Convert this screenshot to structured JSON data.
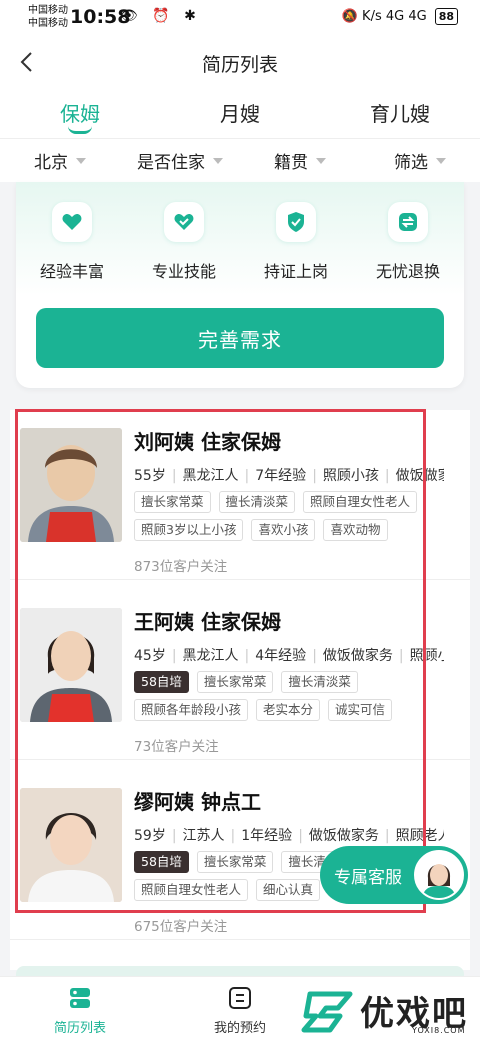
{
  "status_bar": {
    "carrier1": "中国移动",
    "carrier2": "中国移动",
    "time": "10:58",
    "left_icons": "👁 ⏰ ✱",
    "right_icons": "🔕 K/s 4G 4G",
    "battery": "88"
  },
  "navbar": {
    "title": "简历列表"
  },
  "tabs": [
    {
      "label": "保姆",
      "active": true
    },
    {
      "label": "月嫂",
      "active": false
    },
    {
      "label": "育儿嫂",
      "active": false
    }
  ],
  "filters": [
    {
      "label": "北京"
    },
    {
      "label": "是否住家"
    },
    {
      "label": "籍贯"
    },
    {
      "label": "筛选"
    }
  ],
  "promo": {
    "features": [
      {
        "label": "经验丰富",
        "icon": "heart-icon"
      },
      {
        "label": "专业技能",
        "icon": "check-heart-icon"
      },
      {
        "label": "持证上岗",
        "icon": "shield-check-icon"
      },
      {
        "label": "无忧退换",
        "icon": "swap-icon"
      }
    ],
    "cta_label": "完善需求"
  },
  "caregivers": [
    {
      "name": "刘阿姨 住家保姆",
      "age": "55岁",
      "origin": "黑龙江人",
      "experience": "7年经验",
      "skill1": "照顾小孩",
      "skill2": "做饭做家",
      "tags": [
        "擅长家常菜",
        "擅长清淡菜",
        "照顾自理女性老人",
        "照顾3岁以上小孩",
        "喜欢小孩",
        "喜欢动物"
      ],
      "followers": "873位客户关注"
    },
    {
      "name": "王阿姨 住家保姆",
      "age": "45岁",
      "origin": "黑龙江人",
      "experience": "4年经验",
      "skill1": "做饭做家务",
      "skill2": "照顾小孩",
      "badge": "58自培",
      "tags": [
        "擅长家常菜",
        "擅长清淡菜",
        "照顾各年龄段小孩",
        "老实本分",
        "诚实可信"
      ],
      "followers": "73位客户关注"
    },
    {
      "name": "缪阿姨 钟点工",
      "age": "59岁",
      "origin": "江苏人",
      "experience": "1年经验",
      "skill1": "做饭做家务",
      "skill2": "照顾老人",
      "badge": "58自培",
      "tags": [
        "擅长家常菜",
        "擅长清淡菜",
        "照顾自理女性老人",
        "细心认真"
      ],
      "followers": "675位客户关注"
    }
  ],
  "service": {
    "label": "专属客服"
  },
  "bottom_nav": [
    {
      "label": "简历列表",
      "icon": "list-icon",
      "active": true
    },
    {
      "label": "我的预约",
      "icon": "appointment-icon",
      "active": false
    }
  ],
  "watermark": {
    "text": "优戏吧",
    "sub": "YOXI8.COM"
  },
  "colors": {
    "accent": "#1bb394",
    "highlight": "#e03e4e",
    "badge_dark": "#3a3030"
  }
}
